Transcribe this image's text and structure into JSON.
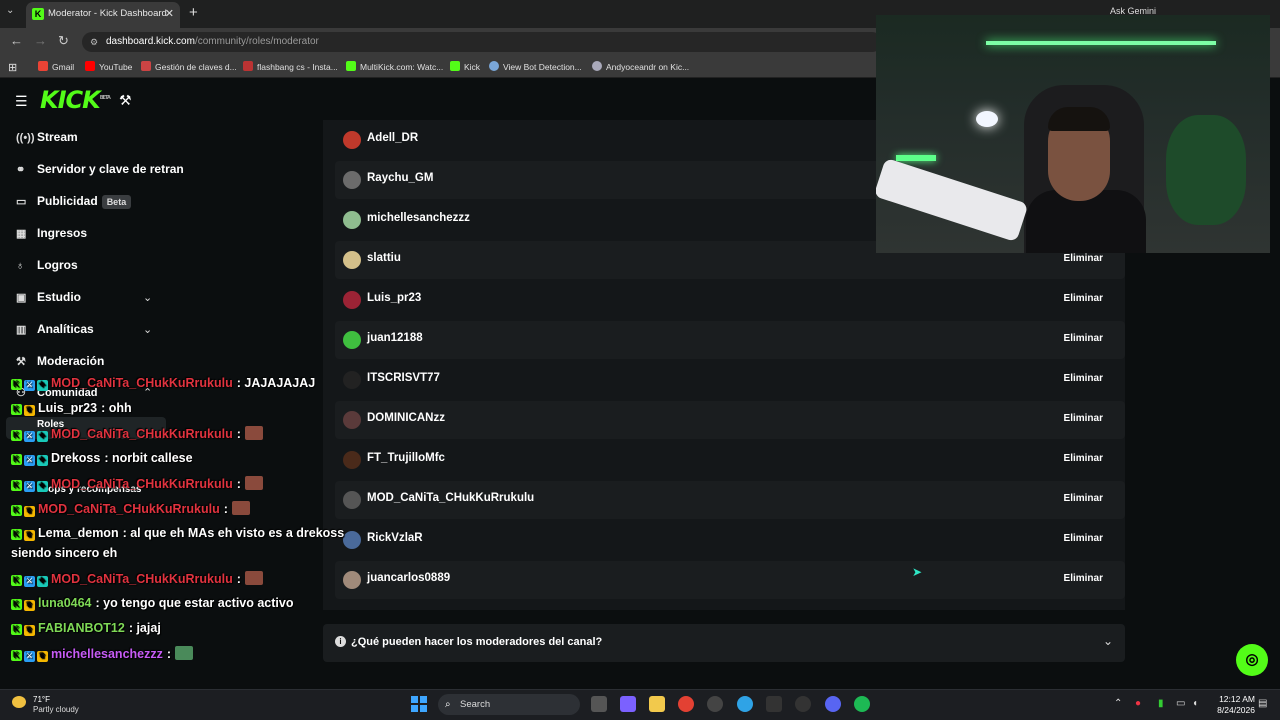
{
  "browser": {
    "tab_title": "Moderator - Kick Dashboard",
    "url_host": "dashboard.kick.com",
    "url_path": "/community/roles/moderator",
    "ask_gemini": "Ask Gemini",
    "bookmarks": [
      "Gmail",
      "YouTube",
      "Gestión de claves d...",
      "flashbang cs - Insta...",
      "MultiKick.com: Watc...",
      "Kick",
      "View Bot Detection...",
      "Andyoceandr on Kic..."
    ]
  },
  "header": {
    "logo": "KICK",
    "logo_sup": "BETA"
  },
  "sidebar": {
    "stream": "Stream",
    "server": "Servidor y clave de retran",
    "ads": "Publicidad",
    "ads_badge": "Beta",
    "income": "Ingresos",
    "achievements": "Logros",
    "studio": "Estudio",
    "analytics": "Analíticas",
    "moderation": "Moderación",
    "community": "Comunidad",
    "roles": "Roles",
    "drops": "Drops y recompensas"
  },
  "chat": [
    {
      "user": "MOD_CaNiTa_CHukKuRrukulu",
      "msg": ": JAJAJAJAJ"
    },
    {
      "user": "Luis_pr23",
      "msg": ": ohh"
    },
    {
      "user": "MOD_CaNiTa_CHukKuRrukulu",
      "msg": ":"
    },
    {
      "user": "Drekoss",
      "msg": ": norbit callese"
    },
    {
      "user": "MOD_CaNiTa_CHukKuRrukulu",
      "msg": ":"
    },
    {
      "user": "MOD_CaNiTa_CHukKuRrukulu",
      "msg": ":"
    },
    {
      "user": "Lema_demon",
      "msg": ": al que eh MAs eh visto es a drekoss",
      "msg2": "siendo sincero eh"
    },
    {
      "user": "MOD_CaNiTa_CHukKuRrukulu",
      "msg": ":"
    },
    {
      "user": "luna0464",
      "msg": ": yo tengo que estar activo activo"
    },
    {
      "user": "FABIANBOT12",
      "msg": ": jajaj"
    },
    {
      "user": "michellesanchezzz",
      "msg": ":"
    }
  ],
  "moderators": {
    "remove_label": "Eliminar",
    "list": [
      {
        "name": "Adell_DR",
        "color": "#c0392b"
      },
      {
        "name": "Raychu_GM",
        "color": "#6b6b6b"
      },
      {
        "name": "michellesanchezzz",
        "color": "#8fbc8f"
      },
      {
        "name": "slattiu",
        "color": "#d4c08a"
      },
      {
        "name": "Luis_pr23",
        "color": "#9b2335"
      },
      {
        "name": "juan12188",
        "color": "#3fbf3f"
      },
      {
        "name": "ITSCRISVT77",
        "color": "#222222"
      },
      {
        "name": "DOMINICANzz",
        "color": "#5a3a3a"
      },
      {
        "name": "FT_TrujilloMfc",
        "color": "#4a2a1a"
      },
      {
        "name": "MOD_CaNiTa_CHukKuRrukulu",
        "color": "#555555"
      },
      {
        "name": "RickVzlaR",
        "color": "#4a6a9a"
      },
      {
        "name": "juancarlos0889",
        "color": "#a08a7a"
      }
    ]
  },
  "faq": {
    "question": "¿Qué pueden hacer los moderadores del canal?"
  },
  "taskbar": {
    "temp": "71°F",
    "weather": "Partly cloudy",
    "search": "Search",
    "time": "12:12 AM",
    "date": "8/24/2026"
  },
  "colors": {
    "kick_green": "#53fc18",
    "mod_red": "#e0333f"
  }
}
